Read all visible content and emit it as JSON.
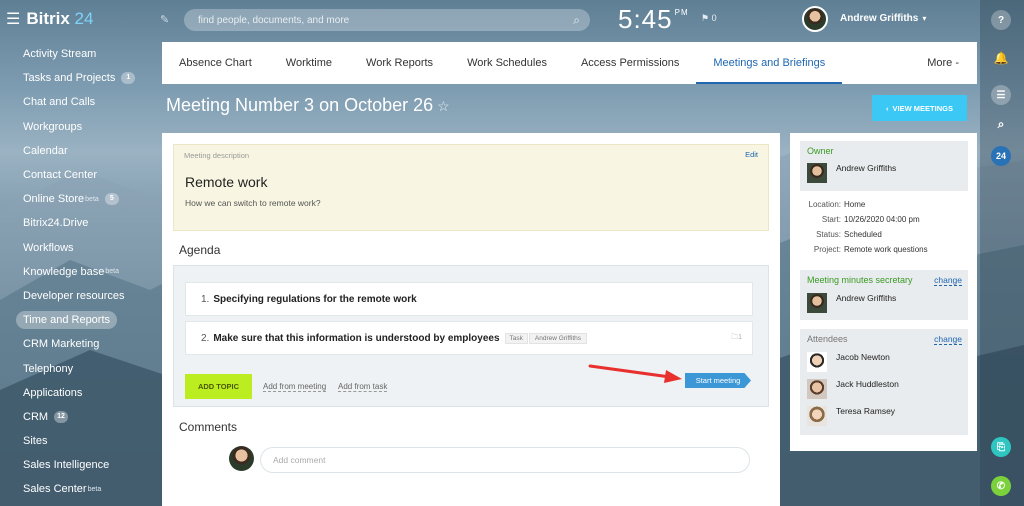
{
  "topbar": {
    "logo_main": "Bitrix",
    "logo_24": "24",
    "search_placeholder": "find people, documents, and more",
    "time": "5:45",
    "ampm": "PM",
    "notifications": "0",
    "user_name": "Andrew Griffiths"
  },
  "sidebar": {
    "items": [
      {
        "label": "Activity Stream",
        "badge": "",
        "sup": ""
      },
      {
        "label": "Tasks and Projects",
        "badge": "1",
        "sup": ""
      },
      {
        "label": "Chat and Calls",
        "badge": "",
        "sup": ""
      },
      {
        "label": "Workgroups",
        "badge": "",
        "sup": ""
      },
      {
        "label": "Calendar",
        "badge": "",
        "sup": ""
      },
      {
        "label": "Contact Center",
        "badge": "",
        "sup": ""
      },
      {
        "label": "Online Store",
        "badge": "5",
        "sup": "beta"
      },
      {
        "label": "Bitrix24.Drive",
        "badge": "",
        "sup": ""
      },
      {
        "label": "Workflows",
        "badge": "",
        "sup": ""
      },
      {
        "label": "Knowledge base",
        "badge": "",
        "sup": "beta"
      },
      {
        "label": "Developer resources",
        "badge": "",
        "sup": ""
      },
      {
        "label": "Time and Reports",
        "badge": "",
        "sup": ""
      },
      {
        "label": "CRM Marketing",
        "badge": "",
        "sup": ""
      },
      {
        "label": "Telephony",
        "badge": "",
        "sup": ""
      },
      {
        "label": "Applications",
        "badge": "",
        "sup": ""
      },
      {
        "label": "CRM",
        "badge": "12",
        "sup": ""
      },
      {
        "label": "Sites",
        "badge": "",
        "sup": ""
      },
      {
        "label": "Sales Intelligence",
        "badge": "",
        "sup": ""
      },
      {
        "label": "Sales Center",
        "badge": "",
        "sup": "beta"
      }
    ]
  },
  "tabs": [
    {
      "label": "Absence Chart"
    },
    {
      "label": "Worktime"
    },
    {
      "label": "Work Reports"
    },
    {
      "label": "Work Schedules"
    },
    {
      "label": "Access Permissions"
    },
    {
      "label": "Meetings and Briefings"
    },
    {
      "label": "More"
    }
  ],
  "page": {
    "title": "Meeting Number 3 on October 26",
    "view_button": "VIEW MEETINGS"
  },
  "description": {
    "label": "Meeting description",
    "edit": "Edit",
    "title": "Remote work",
    "text": "How we can switch to remote work?"
  },
  "agenda": {
    "heading": "Agenda",
    "items": [
      {
        "num": "1.",
        "text": "Specifying regulations for the remote work"
      },
      {
        "num": "2.",
        "text": "Make sure that this information is understood by employees",
        "tag": "Task",
        "tag_user": "Andrew Griffiths",
        "count": "1"
      }
    ],
    "add_topic": "ADD TOPIC",
    "add_from_meeting": "Add from meeting",
    "add_from_task": "Add from task",
    "start_meeting": "Start meeting"
  },
  "comments": {
    "heading": "Comments",
    "placeholder": "Add comment"
  },
  "info": {
    "owner_label": "Owner",
    "owner_name": "Andrew Griffiths",
    "location_k": "Location:",
    "location_v": "Home",
    "start_k": "Start:",
    "start_v": "10/26/2020 04:00 pm",
    "status_k": "Status:",
    "status_v": "Scheduled",
    "project_k": "Project:",
    "project_v": "Remote work questions",
    "secretary_label": "Meeting minutes secretary",
    "secretary_change": "change",
    "secretary_name": "Andrew Griffiths",
    "attendees_label": "Attendees",
    "attendees_change": "change",
    "attendees": [
      "Jacob Newton",
      "Jack Huddleston",
      "Teresa Ramsey"
    ]
  },
  "rail": {
    "b24": "24"
  },
  "colors": {
    "accent": "#2067b0",
    "add_topic": "#bbed21",
    "view_button": "#3bc8f5",
    "start_button": "#3b97d6",
    "arrow": "#e8312f"
  }
}
